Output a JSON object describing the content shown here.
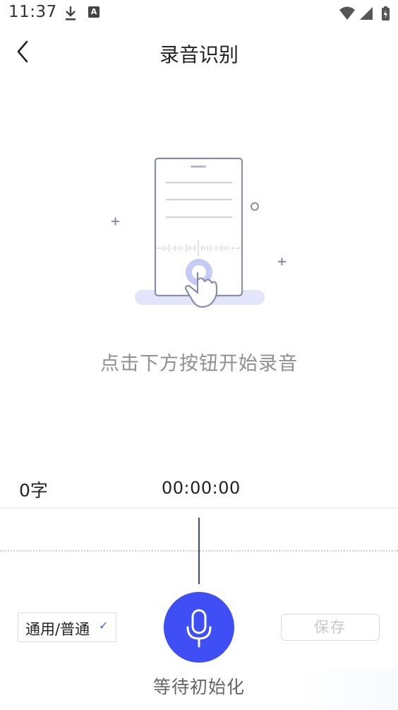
{
  "status_bar": {
    "time": "11:37",
    "download_icon": "download-icon",
    "notification_badge": "A",
    "wifi_icon": "wifi-icon",
    "signal_icon": "signal-icon",
    "battery_icon": "battery-charging-icon"
  },
  "header": {
    "back_icon": "chevron-left-icon",
    "title": "录音识别"
  },
  "illustration": {
    "icon": "phone-tap-illustration-icon"
  },
  "hint": "点击下方按钮开始录音",
  "info": {
    "word_count": "0字",
    "timer": "00:00:00"
  },
  "controls": {
    "language": "通用/普通",
    "mic_icon": "microphone-icon",
    "save_label": "保存",
    "status": "等待初始化"
  },
  "colors": {
    "accent": "#3f4ff5",
    "playhead": "#3b4796",
    "hint_text": "#8f8f96",
    "illustration_stroke": "#8a8da3",
    "illustration_fill": "#e3e5fb"
  }
}
